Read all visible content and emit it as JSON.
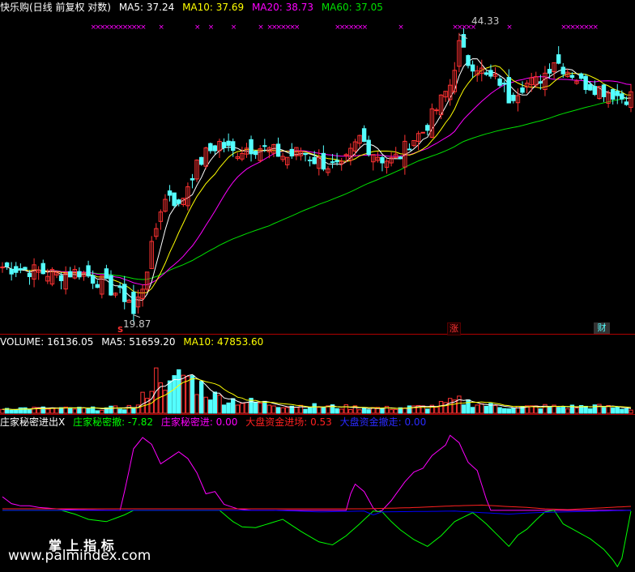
{
  "colors": {
    "background": "#000000",
    "up": "#ff3232",
    "down": "#54ffff",
    "ma5": "#ffffff",
    "ma10": "#ffff00",
    "ma20": "#ff00ff",
    "ma60": "#00e000",
    "pane_border": "#b00000",
    "flag": "#ff00ff",
    "main_force": "#00ff00",
    "secret": "#ff00ff",
    "big_in": "#ff2020",
    "big_out": "#0000ff"
  },
  "header": {
    "stock": "快乐购(日线 前复权 对数)",
    "ma5": "MA5: 37.24",
    "ma10": "MA10: 37.69",
    "ma20": "MA20: 38.73",
    "ma60": "MA60: 37.05"
  },
  "volume_header": {
    "volume": "VOLUME: 16136.05",
    "ma5": "MA5: 51659.20",
    "ma10": "MA10: 47853.60"
  },
  "indicator_header": {
    "name": "庄家秘密进出X",
    "main_force": "庄家秘密撤: -7.82",
    "secret_in": "庄家秘密进: 0.00",
    "big_in": "大盘资金进场: 0.53",
    "big_out": "大盘资金撤走: 0.00"
  },
  "annotations": {
    "high": "44.33",
    "low": "19.87",
    "low_marker": "S",
    "tag_rise": "涨",
    "tag_finance": "财"
  },
  "watermark": {
    "line1": "掌 上 指 标",
    "line2": "www.palmindex.com"
  },
  "chart_data": [
    {
      "type": "line",
      "title": "快乐购(日线 前复权 对数)",
      "log_scale": true,
      "days": 140,
      "ylim": [
        19.0,
        46.5
      ],
      "close_path": [
        [
          0,
          22.8
        ],
        [
          6,
          22.6
        ],
        [
          12,
          22.3
        ],
        [
          17,
          22.5
        ],
        [
          22,
          21.8
        ],
        [
          25,
          21.2
        ],
        [
          28,
          20.8
        ],
        [
          29,
          19.9
        ],
        [
          31,
          21.6
        ],
        [
          33,
          24.0
        ],
        [
          35,
          27.0
        ],
        [
          37,
          28.2
        ],
        [
          39,
          27.0
        ],
        [
          42,
          29.8
        ],
        [
          45,
          31.5
        ],
        [
          48,
          32.5
        ],
        [
          51,
          31.6
        ],
        [
          54,
          32.1
        ],
        [
          57,
          32.1
        ],
        [
          60,
          31.7
        ],
        [
          63,
          31.2
        ],
        [
          66,
          31.8
        ],
        [
          69,
          31.0
        ],
        [
          72,
          30.5
        ],
        [
          75,
          30.2
        ],
        [
          77,
          31.5
        ],
        [
          79,
          33.0
        ],
        [
          82,
          31.7
        ],
        [
          84,
          31.1
        ],
        [
          86,
          30.9
        ],
        [
          88,
          31.4
        ],
        [
          90,
          32.6
        ],
        [
          93,
          33.6
        ],
        [
          96,
          35.8
        ],
        [
          99,
          38.4
        ],
        [
          101,
          43.0
        ],
        [
          103,
          41.0
        ],
        [
          105,
          40.6
        ],
        [
          107,
          39.2
        ],
        [
          110,
          38.8
        ],
        [
          112,
          37.0
        ],
        [
          115,
          38.4
        ],
        [
          118,
          38.7
        ],
        [
          120,
          39.7
        ],
        [
          122,
          41.3
        ],
        [
          124,
          40.4
        ],
        [
          126,
          39.7
        ],
        [
          128,
          38.6
        ],
        [
          130,
          38.4
        ],
        [
          133,
          37.8
        ],
        [
          135,
          37.5
        ],
        [
          137,
          37.0
        ],
        [
          139,
          37.2
        ]
      ],
      "series": [
        {
          "name": "MA5",
          "value": 37.24
        },
        {
          "name": "MA10",
          "value": 37.69
        },
        {
          "name": "MA20",
          "value": 38.73
        },
        {
          "name": "MA60",
          "value": 37.05
        }
      ],
      "labeled_points": [
        {
          "day": 101,
          "price": 44.33,
          "label": "44.33"
        },
        {
          "day": 29,
          "price": 19.87,
          "label": "19.87"
        }
      ]
    },
    {
      "type": "bar",
      "title": "VOLUME",
      "ylim": [
        0,
        260000
      ],
      "volume_path": [
        [
          0,
          18000
        ],
        [
          10,
          17000
        ],
        [
          20,
          16000
        ],
        [
          26,
          19000
        ],
        [
          30,
          26000
        ],
        [
          32,
          85000
        ],
        [
          34,
          130000
        ],
        [
          35,
          165000
        ],
        [
          37,
          90000
        ],
        [
          40,
          142000
        ],
        [
          42,
          118000
        ],
        [
          44,
          96000
        ],
        [
          47,
          60000
        ],
        [
          52,
          45000
        ],
        [
          58,
          35000
        ],
        [
          65,
          27000
        ],
        [
          75,
          22000
        ],
        [
          85,
          18000
        ],
        [
          95,
          24000
        ],
        [
          101,
          45000
        ],
        [
          108,
          27000
        ],
        [
          115,
          21000
        ],
        [
          120,
          24000
        ],
        [
          125,
          22000
        ],
        [
          130,
          25000
        ],
        [
          135,
          21000
        ],
        [
          139,
          16136
        ]
      ],
      "series": [
        {
          "name": "VOLUME",
          "value": 16136.05
        },
        {
          "name": "MA5",
          "value": 51659.2
        },
        {
          "name": "MA10",
          "value": 47853.6
        }
      ]
    },
    {
      "type": "line",
      "title": "庄家秘密进出X",
      "ylim": [
        -8,
        11
      ],
      "series": [
        {
          "name": "庄家秘密撤",
          "value": -7.82,
          "points": [
            [
              0,
              0
            ],
            [
              13,
              0
            ],
            [
              16,
              -0.5
            ],
            [
              19,
              -1.2
            ],
            [
              23,
              -1.5
            ],
            [
              27,
              -0.6
            ],
            [
              29,
              0
            ],
            [
              45,
              0
            ],
            [
              48,
              0
            ],
            [
              51,
              -1.5
            ],
            [
              53,
              -2.2
            ],
            [
              56,
              -2.3
            ],
            [
              62,
              -1.2
            ],
            [
              66,
              -2.8
            ],
            [
              70,
              -4.2
            ],
            [
              73,
              -4.6
            ],
            [
              76,
              -3.4
            ],
            [
              79,
              -1.8
            ],
            [
              82,
              -0.1
            ],
            [
              84,
              -0.2
            ],
            [
              86,
              -1.5
            ],
            [
              88,
              -2.6
            ],
            [
              91,
              -3.9
            ],
            [
              94,
              -4.8
            ],
            [
              97,
              -3.4
            ],
            [
              100,
              -1.5
            ],
            [
              104,
              -0.3
            ],
            [
              107,
              -1.8
            ],
            [
              110,
              -3.6
            ],
            [
              112,
              -4.8
            ],
            [
              114,
              -3.3
            ],
            [
              116,
              -2.5
            ],
            [
              118,
              -1.3
            ],
            [
              120,
              -0.2
            ],
            [
              122,
              0
            ],
            [
              124,
              -1.8
            ],
            [
              127,
              -2.8
            ],
            [
              130,
              -3.8
            ],
            [
              133,
              -5.2
            ],
            [
              135,
              -6.6
            ],
            [
              136,
              -7.5
            ],
            [
              137,
              -6.4
            ],
            [
              139,
              -0.1
            ]
          ]
        },
        {
          "name": "庄家秘密进",
          "value": 0.0,
          "points": [
            [
              0,
              1.8
            ],
            [
              2,
              0.9
            ],
            [
              4,
              0.6
            ],
            [
              6,
              0.6
            ],
            [
              8,
              0.4
            ],
            [
              10,
              0.3
            ],
            [
              12,
              0.2
            ],
            [
              14,
              0.1
            ],
            [
              26,
              0
            ],
            [
              27,
              2.5
            ],
            [
              28,
              5.3
            ],
            [
              29,
              8.2
            ],
            [
              31,
              9.7
            ],
            [
              33,
              8.8
            ],
            [
              35,
              6.2
            ],
            [
              37,
              7.0
            ],
            [
              39,
              7.8
            ],
            [
              41,
              6.9
            ],
            [
              43,
              5.0
            ],
            [
              45,
              2.2
            ],
            [
              47,
              2.5
            ],
            [
              49,
              0.8
            ],
            [
              52,
              0.2
            ],
            [
              55,
              0
            ],
            [
              76,
              0
            ],
            [
              77,
              2.2
            ],
            [
              78,
              3.5
            ],
            [
              80,
              2.5
            ],
            [
              82,
              0.3
            ],
            [
              83,
              -0.2
            ],
            [
              84,
              0
            ],
            [
              86,
              1.3
            ],
            [
              89,
              3.8
            ],
            [
              91,
              5.1
            ],
            [
              93,
              5.6
            ],
            [
              95,
              7.3
            ],
            [
              98,
              8.7
            ],
            [
              99,
              10.0
            ],
            [
              101,
              9.0
            ],
            [
              103,
              6.4
            ],
            [
              105,
              5.3
            ],
            [
              107,
              1.5
            ],
            [
              108,
              0
            ],
            [
              139,
              0
            ]
          ]
        },
        {
          "name": "大盘资金进场",
          "value": 0.53,
          "points": [
            [
              0,
              0.2
            ],
            [
              40,
              0.2
            ],
            [
              80,
              0.2
            ],
            [
              90,
              0.35
            ],
            [
              100,
              0.6
            ],
            [
              106,
              0.7
            ],
            [
              112,
              0.5
            ],
            [
              116,
              0.4
            ],
            [
              120,
              0.2
            ],
            [
              125,
              0.1
            ],
            [
              139,
              0.53
            ]
          ]
        },
        {
          "name": "大盘资金撤走",
          "value": 0.0,
          "points": [
            [
              0,
              0
            ],
            [
              40,
              0
            ],
            [
              60,
              0
            ],
            [
              70,
              -0.2
            ],
            [
              80,
              -0.1
            ],
            [
              82,
              -0.6
            ],
            [
              84,
              -0.2
            ],
            [
              100,
              -0.1
            ],
            [
              112,
              -0.5
            ],
            [
              118,
              -0.3
            ],
            [
              125,
              -0.2
            ],
            [
              139,
              0
            ]
          ]
        }
      ]
    }
  ]
}
